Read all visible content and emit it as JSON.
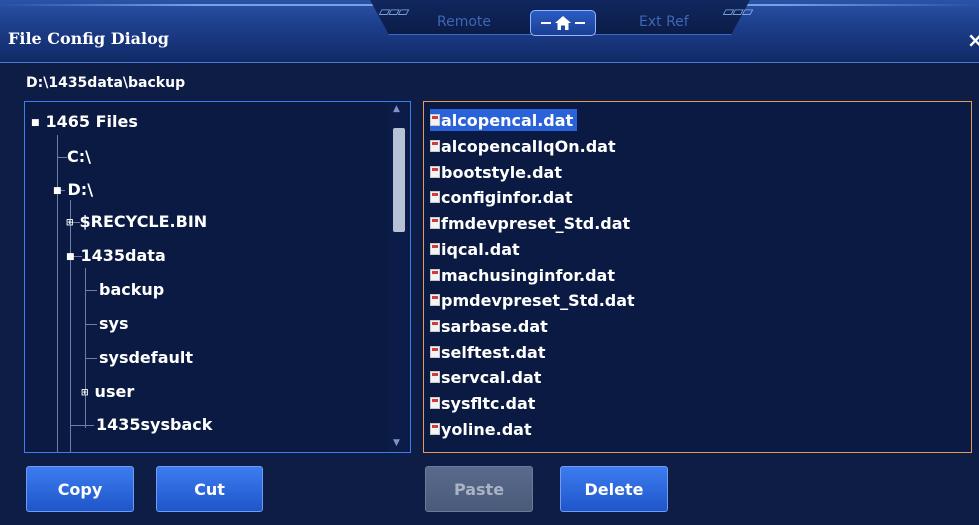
{
  "window": {
    "title": "File Config Dialog",
    "close_symbol": "×",
    "tabs": {
      "left": "Remote",
      "right": "Ext Ref"
    }
  },
  "path": "D:\\1435data\\backup",
  "tree": [
    {
      "label": "1465 Files",
      "expander": "■"
    },
    {
      "label": "C:\\",
      "expander": ""
    },
    {
      "label": "D:\\",
      "expander": "■"
    },
    {
      "label": "$RECYCLE.BIN",
      "expander": "⊞"
    },
    {
      "label": "1435data",
      "expander": "■"
    },
    {
      "label": "backup",
      "expander": ""
    },
    {
      "label": "sys",
      "expander": ""
    },
    {
      "label": "sysdefault",
      "expander": ""
    },
    {
      "label": "user",
      "expander": "⊞"
    },
    {
      "label": "1435sysback",
      "expander": ""
    }
  ],
  "files": [
    "alcopencal.dat",
    "alcopencalIqOn.dat",
    "bootstyle.dat",
    "configinfor.dat",
    "fmdevpreset_Std.dat",
    "iqcal.dat",
    "machusinginfor.dat",
    "pmdevpreset_Std.dat",
    "sarbase.dat",
    "selftest.dat",
    "servcal.dat",
    "sysfltc.dat",
    "yoline.dat"
  ],
  "selected_file": "alcopencal.dat",
  "buttons": {
    "copy": "Copy",
    "cut": "Cut",
    "paste": "Paste",
    "delete": "Delete"
  },
  "colors": {
    "tree_border": "#3e7cf0",
    "file_border": "#e69a5a",
    "selection": "#2a63d9"
  }
}
